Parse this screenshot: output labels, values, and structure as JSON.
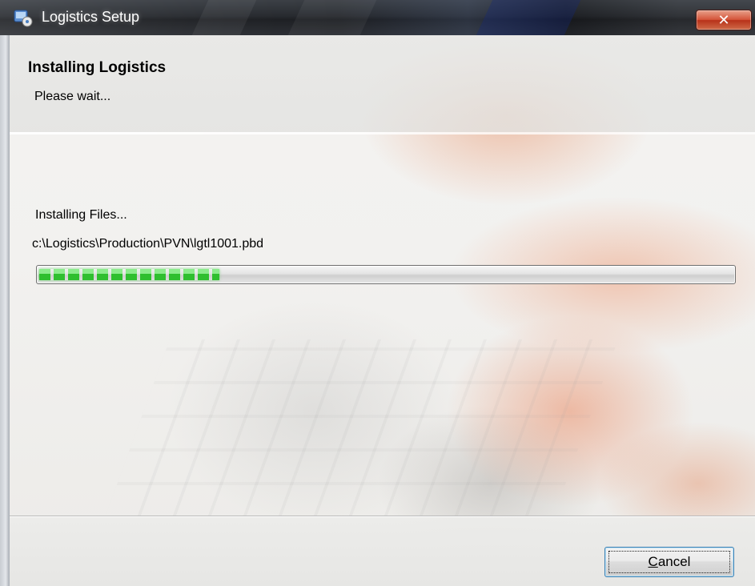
{
  "window": {
    "title": "Logistics Setup",
    "close_label": "✕"
  },
  "header": {
    "title": "Installing Logistics",
    "subtitle": "Please wait..."
  },
  "progress": {
    "status": "Installing Files...",
    "current_file": "c:\\Logistics\\Production\\PVN\\lgtl1001.pbd",
    "fraction": 0.26
  },
  "footer": {
    "cancel_accel": "C",
    "cancel_rest": "ancel"
  },
  "colors": {
    "progress_green": "#2fbf2f",
    "close_red": "#d5553a",
    "button_focus_border": "#3c7fb1"
  }
}
